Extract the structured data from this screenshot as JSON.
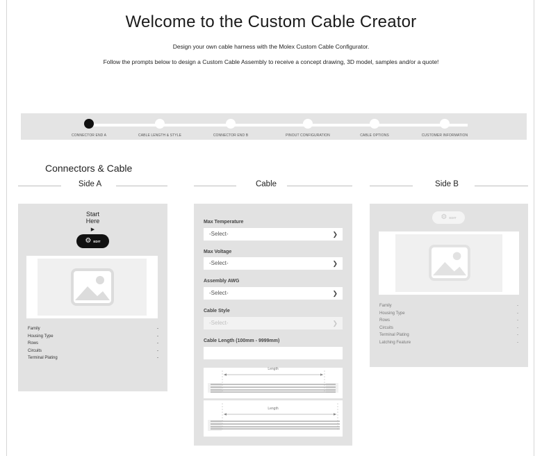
{
  "header": {
    "title": "Welcome to the Custom Cable Creator",
    "subtitle1": "Design your own cable harness with the Molex Custom Cable Configurator.",
    "subtitle2": "Follow the prompts below to design a Custom Cable Assembly to receive a concept drawing, 3D model, samples and/or a quote!"
  },
  "stepper": {
    "steps": [
      {
        "label": "Connector End A",
        "active": true
      },
      {
        "label": "Cable Length & Style",
        "active": false
      },
      {
        "label": "Connector End B",
        "active": false
      },
      {
        "label": "Pinout Configuration",
        "active": false
      },
      {
        "label": "Cable Options",
        "active": false
      },
      {
        "label": "Customer Information",
        "active": false
      }
    ]
  },
  "section_title": "Connectors & Cable",
  "columns": {
    "side_a": "Side A",
    "cable": "Cable",
    "side_b": "Side B"
  },
  "side_a": {
    "start_line1": "Start",
    "start_line2": "Here",
    "arrow": "▶",
    "edit_label": "Edit",
    "specs": [
      {
        "label": "Family",
        "value": "-"
      },
      {
        "label": "Housing Type",
        "value": "-"
      },
      {
        "label": "Rows",
        "value": "-"
      },
      {
        "label": "Circuits",
        "value": "-"
      },
      {
        "label": "Terminal Plating",
        "value": "-"
      }
    ]
  },
  "cable": {
    "max_temperature": {
      "label": "Max Temperature",
      "value": "-Select-"
    },
    "max_voltage": {
      "label": "Max Voltage",
      "value": "-Select-"
    },
    "assembly_awg": {
      "label": "Assembly AWG",
      "value": "-Select-"
    },
    "cable_style": {
      "label": "Cable Style",
      "value": "-Select-"
    },
    "cable_length": {
      "label": "Cable Length (100mm - 9999mm)",
      "value": ""
    },
    "diagram1_label": "Length",
    "diagram2_label": "Length"
  },
  "side_b": {
    "edit_label": "Edit",
    "specs": [
      {
        "label": "Family",
        "value": "-"
      },
      {
        "label": "Housing Type",
        "value": "-"
      },
      {
        "label": "Rows",
        "value": "-"
      },
      {
        "label": "Circuits",
        "value": "-"
      },
      {
        "label": "Terminal Plating",
        "value": "-"
      },
      {
        "label": "Latching Feature",
        "value": "-"
      }
    ]
  },
  "colors": {
    "panel_bg": "#e2e2e2",
    "stepper_bg": "#e4e4e4",
    "active_step": "#111111",
    "edit_active_bg": "#111111"
  },
  "icons": {
    "edit": "gear-icon",
    "image_placeholder": "image-placeholder-icon",
    "select": "chevron-down-icon",
    "start_arrow": "play-arrow-icon"
  }
}
